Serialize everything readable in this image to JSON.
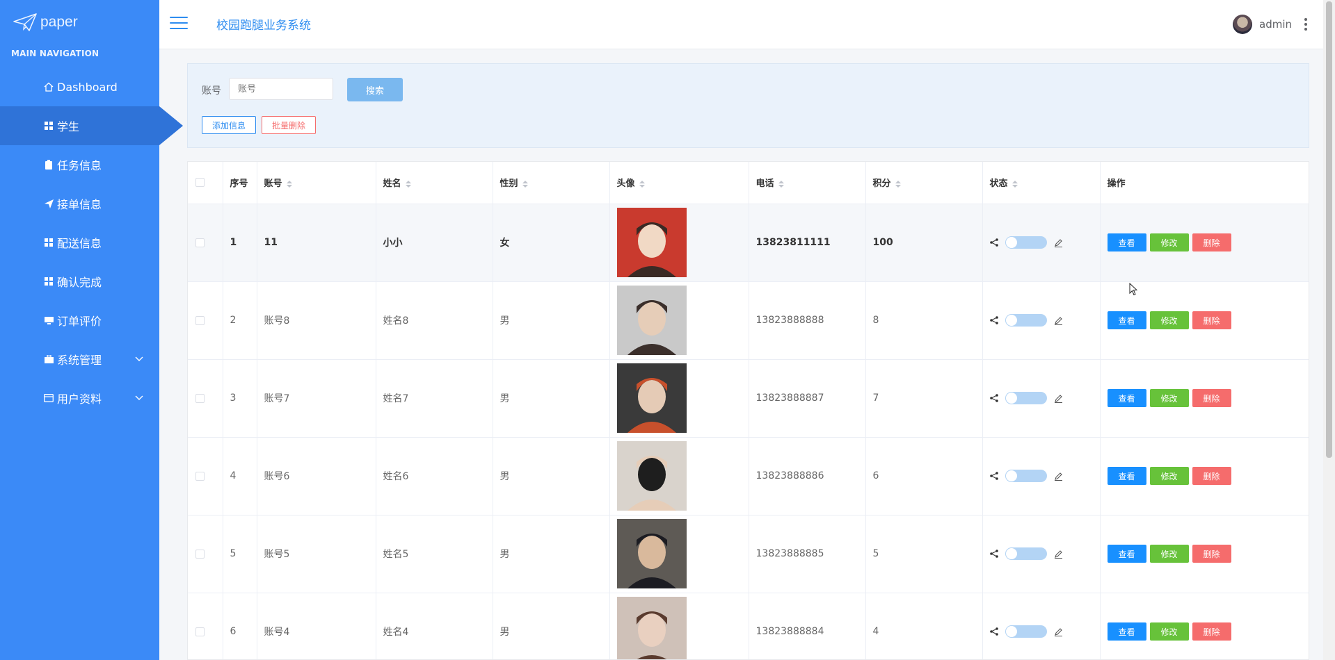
{
  "app": {
    "logo_text": "paper",
    "title": "校园跑腿业务系统",
    "user": "admin"
  },
  "sidebar": {
    "header": "MAIN NAVIGATION",
    "items": [
      {
        "label": "Dashboard",
        "icon": "home-icon"
      },
      {
        "label": "学生",
        "icon": "grid-icon",
        "active": true
      },
      {
        "label": "任务信息",
        "icon": "clipboard-icon"
      },
      {
        "label": "接单信息",
        "icon": "send-icon"
      },
      {
        "label": "配送信息",
        "icon": "grid-icon"
      },
      {
        "label": "确认完成",
        "icon": "grid-icon"
      },
      {
        "label": "订单评价",
        "icon": "monitor-icon"
      },
      {
        "label": "系统管理",
        "icon": "briefcase-icon",
        "expandable": true
      },
      {
        "label": "用户资料",
        "icon": "id-card-icon",
        "expandable": true
      }
    ]
  },
  "search": {
    "label": "账号",
    "placeholder": "账号",
    "button": "搜索",
    "add_button": "添加信息",
    "batch_delete_button": "批量删除"
  },
  "table": {
    "columns": [
      "序号",
      "账号",
      "姓名",
      "性别",
      "头像",
      "电话",
      "积分",
      "状态",
      "操作"
    ],
    "actions": {
      "view": "查看",
      "edit": "修改",
      "delete": "删除"
    },
    "rows": [
      {
        "no": "1",
        "account": "11",
        "name": "小小",
        "gender": "女",
        "phone": "13823811111",
        "points": "100"
      },
      {
        "no": "2",
        "account": "账号8",
        "name": "姓名8",
        "gender": "男",
        "phone": "13823888888",
        "points": "8"
      },
      {
        "no": "3",
        "account": "账号7",
        "name": "姓名7",
        "gender": "男",
        "phone": "13823888887",
        "points": "7"
      },
      {
        "no": "4",
        "account": "账号6",
        "name": "姓名6",
        "gender": "男",
        "phone": "13823888886",
        "points": "6"
      },
      {
        "no": "5",
        "account": "账号5",
        "name": "姓名5",
        "gender": "男",
        "phone": "13823888885",
        "points": "5"
      },
      {
        "no": "6",
        "account": "账号4",
        "name": "姓名4",
        "gender": "男",
        "phone": "13823888884",
        "points": "4"
      }
    ]
  },
  "colors": {
    "sidebar": "#3b8af7",
    "sidebar_active": "#2f73d8",
    "primary": "#1890ff",
    "success": "#67c23a",
    "danger": "#f56c6c"
  }
}
